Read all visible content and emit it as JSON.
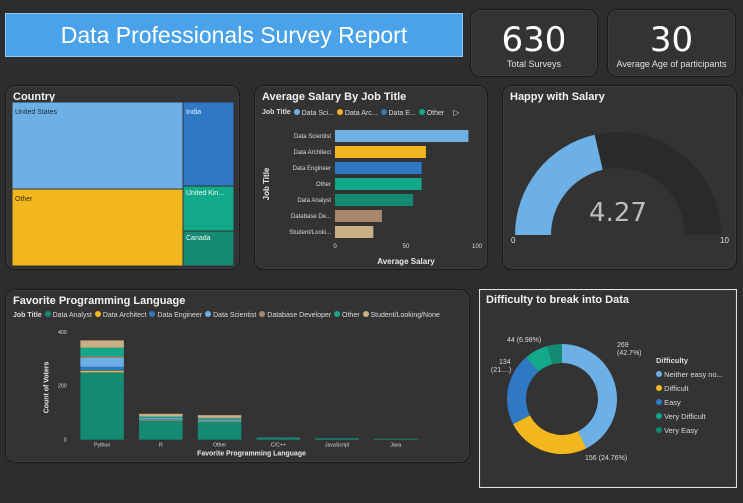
{
  "header": {
    "title": "Data Professionals Survey Report"
  },
  "kpis": [
    {
      "value": "630",
      "label": "Total Surveys"
    },
    {
      "value": "30",
      "label": "Average Age of participants"
    }
  ],
  "colors": {
    "lightblue": "#6cb0e6",
    "gold": "#f2b71c",
    "blue": "#2f79c4",
    "teal": "#12a98a",
    "darkteal": "#148a73",
    "tan": "#a8876a",
    "beige": "#c8b084"
  },
  "country": {
    "title": "Country",
    "tiles": [
      "United States",
      "Other",
      "India",
      "United Kin...",
      "Canada"
    ]
  },
  "salary": {
    "title": "Average Salary By Job Title",
    "legend_label": "Job Title",
    "legend_items": [
      "Data Sci...",
      "Data Arc...",
      "Data E...",
      "Other"
    ],
    "chart_data": {
      "type": "bar",
      "orientation": "horizontal",
      "categories": [
        "Data Scientist",
        "Data Architect",
        "Data Engineer",
        "Other",
        "Data Analyst",
        "Database De...",
        "Student/Looki..."
      ],
      "values": [
        94,
        64,
        61,
        61,
        55,
        33,
        27
      ],
      "xlabel": "Average Salary",
      "ylabel": "Job Title",
      "xlim": [
        0,
        100
      ],
      "xticks": [
        "0",
        "50",
        "100"
      ]
    }
  },
  "happy": {
    "title": "Happy with Salary",
    "value": 4.27,
    "value_label": "4.27",
    "min_label": "0",
    "max_label": "10",
    "min": 0,
    "max": 10
  },
  "language": {
    "title": "Favorite Programming Language",
    "legend_label": "Job Title",
    "legend_items": [
      "Data Analyst",
      "Data Architect",
      "Data Engineer",
      "Data Scientist",
      "Database Developer",
      "Other",
      "Student/Looking/None"
    ],
    "chart_data": {
      "type": "bar",
      "stacked": true,
      "categories": [
        "Python",
        "R",
        "Other",
        "C/C++",
        "JavaScript",
        "Java"
      ],
      "series": [
        {
          "name": "Data Analyst",
          "values": [
            250,
            70,
            65,
            8,
            5,
            3
          ]
        },
        {
          "name": "Data Architect",
          "values": [
            6,
            2,
            2,
            0,
            0,
            0
          ]
        },
        {
          "name": "Data Engineer",
          "values": [
            15,
            3,
            3,
            0,
            0,
            0
          ]
        },
        {
          "name": "Data Scientist",
          "values": [
            33,
            4,
            4,
            0,
            0,
            0
          ]
        },
        {
          "name": "Database Developer",
          "values": [
            6,
            2,
            2,
            0,
            0,
            0
          ]
        },
        {
          "name": "Other",
          "values": [
            32,
            5,
            5,
            0,
            0,
            0
          ]
        },
        {
          "name": "Student/Looking/None",
          "values": [
            27,
            10,
            10,
            0,
            0,
            0
          ]
        }
      ],
      "xlabel": "Favorite Programming Language",
      "ylabel": "Count of Voters",
      "ylim": [
        0,
        440
      ],
      "yticks": [
        "0",
        "200",
        "400"
      ]
    }
  },
  "difficulty": {
    "title": "Difficulty to break into Data",
    "legend_title": "Difficulty",
    "legend_items": [
      "Neither easy no...",
      "Difficult",
      "Easy",
      "Very Difficult",
      "Very Easy"
    ],
    "chart_data": {
      "type": "pie",
      "donut": true,
      "labels": [
        "Neither easy nor difficult",
        "Difficult",
        "Easy",
        "Very Difficult",
        "Very Easy"
      ],
      "values": [
        269,
        156,
        134,
        44,
        27
      ]
    },
    "data_labels": {
      "neither_1": "269",
      "neither_2": "(42.7%)",
      "difficult": "156 (24.76%)",
      "easy_1": "134",
      "easy_2": "(21....)",
      "vdiff": "44 (6.98%)"
    }
  }
}
